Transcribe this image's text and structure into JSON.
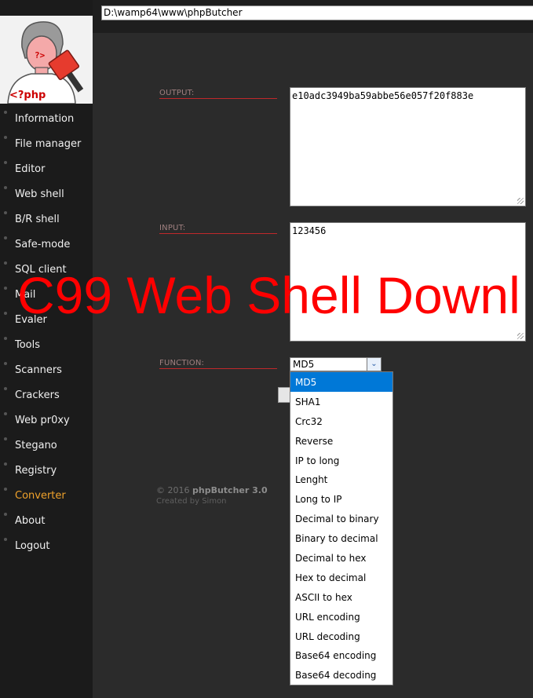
{
  "path_bar": {
    "value": "D:\\wamp64\\www\\phpButcher"
  },
  "logo": {
    "text": "<?php",
    "face_text": "?>"
  },
  "sidebar": {
    "items": [
      {
        "label": "Information"
      },
      {
        "label": "File manager"
      },
      {
        "label": "Editor"
      },
      {
        "label": "Web shell"
      },
      {
        "label": "B/R shell"
      },
      {
        "label": "Safe-mode"
      },
      {
        "label": "SQL client"
      },
      {
        "label": "Mail"
      },
      {
        "label": "Evaler"
      },
      {
        "label": "Tools"
      },
      {
        "label": "Scanners"
      },
      {
        "label": "Crackers"
      },
      {
        "label": "Web pr0xy"
      },
      {
        "label": "Stegano"
      },
      {
        "label": "Registry"
      },
      {
        "label": "Converter",
        "active": true
      },
      {
        "label": "About"
      },
      {
        "label": "Logout"
      }
    ],
    "active_color": "#f0a22b"
  },
  "converter": {
    "output_label": "OUTPUT:",
    "output_value": "e10adc3949ba59abbe56e057f20f883e",
    "input_label": "INPUT:",
    "input_value": "123456",
    "function_label": "FUNCTION:",
    "function_selected": "MD5",
    "function_options": [
      "MD5",
      "SHA1",
      "Crc32",
      "Reverse",
      "IP to long",
      "Lenght",
      "Long to IP",
      "Decimal to binary",
      "Binary to decimal",
      "Decimal to hex",
      "Hex to decimal",
      "ASCII to hex",
      "URL encoding",
      "URL decoding",
      "Base64 encoding",
      "Base64 decoding"
    ]
  },
  "footer": {
    "copyright": "© 2016",
    "product": "phpButcher 3.0",
    "credit": "Created by Simon"
  },
  "watermark": {
    "text": "C99 Web Shell Downl",
    "color": "#ff0000"
  },
  "colors": {
    "label_underline": "#c0292b",
    "selected_option": "#0078d7"
  }
}
